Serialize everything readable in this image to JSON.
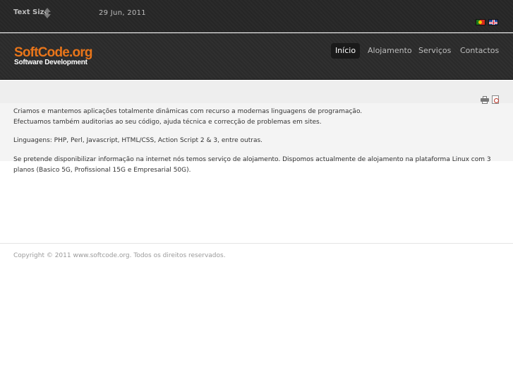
{
  "topbar": {
    "text_size_label": "Text Size",
    "date": "29 Jun, 2011",
    "languages": [
      {
        "code": "pt",
        "icon": "flag-pt-icon"
      },
      {
        "code": "en",
        "icon": "flag-en-icon"
      }
    ]
  },
  "header": {
    "logo_title": "SoftCode.org",
    "logo_subtitle": "Software Development",
    "nav": [
      {
        "label": "Início",
        "active": true
      },
      {
        "label": "Alojamento",
        "active": false
      },
      {
        "label": "Serviços",
        "active": false
      },
      {
        "label": "Contactos",
        "active": false
      }
    ],
    "colors": {
      "accent": "#e8751a",
      "active_nav_bg": "#1a1a1a"
    }
  },
  "toolbar": {
    "print_icon": "print-icon",
    "pdf_icon": "pdf-icon"
  },
  "content": {
    "p1_line1": "Criamos e mantemos aplicações totalmente dinâmicas com recurso a modernas linguagens de programação.",
    "p1_line2": "Efectuamos também auditorias ao seu código, ajuda técnica e correcção de problemas em sites.",
    "p2": "Linguagens: PHP, Perl, Javascript, HTML/CSS, Action Script 2 & 3, entre outras.",
    "p3": "Se pretende disponibilizar informação na internet nós temos serviço de alojamento. Dispomos actualmente de alojamento na plataforma Linux com 3 planos (Basico 5G, Profissional 15G e Empresarial 50G)."
  },
  "footer": {
    "copyright": "Copyright © 2011 www.softcode.org. Todos os direitos reservados."
  }
}
